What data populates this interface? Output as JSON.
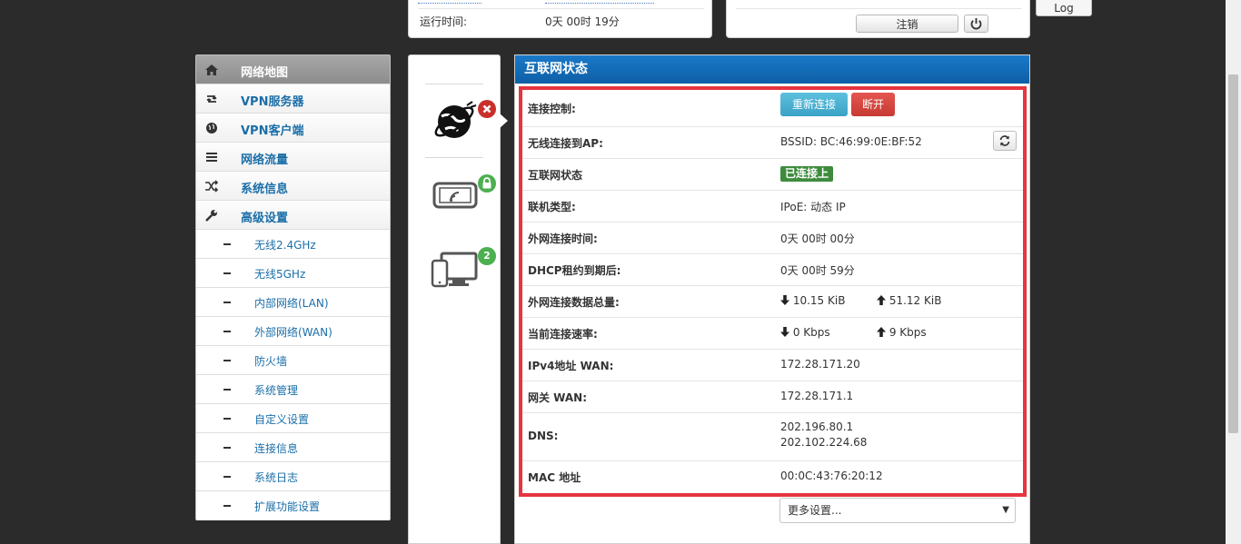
{
  "top_left": {
    "uptime_label": "运行时间:",
    "uptime_value": "0天 00时 19分"
  },
  "top_right": {
    "logout_label": "注销"
  },
  "log_button": "Log",
  "menu": {
    "items": [
      {
        "label": "网络地图",
        "icon": "home-icon",
        "active": true
      },
      {
        "label": "VPN服务器",
        "icon": "retweet-icon"
      },
      {
        "label": "VPN客户端",
        "icon": "globe-icon"
      },
      {
        "label": "网络流量",
        "icon": "list-icon"
      },
      {
        "label": "系统信息",
        "icon": "shuffle-icon"
      },
      {
        "label": "高级设置",
        "icon": "wrench-icon"
      }
    ],
    "sub_items": [
      "无线2.4GHz",
      "无线5GHz",
      "内部网络(LAN)",
      "外部网络(WAN)",
      "防火墙",
      "系统管理",
      "自定义设置",
      "连接信息",
      "系统日志",
      "扩展功能设置"
    ]
  },
  "icons": {
    "client_count": "2"
  },
  "panel": {
    "title": "互联网状态",
    "reconnect": "重新连接",
    "disconnect": "断开",
    "rows": {
      "control": "连接控制:",
      "ap_label": "无线连接到AP:",
      "ap_value": "BSSID: BC:46:99:0E:BF:52",
      "status_label": "互联网状态",
      "status_value": "已连接上",
      "type_label": "联机类型:",
      "type_value": "IPoE: 动态 IP",
      "wan_time_label": "外网连接时间:",
      "wan_time_value": "0天 00时 00分",
      "dhcp_label": "DHCP租约到期后:",
      "dhcp_value": "0天 00时 59分",
      "total_label": "外网连接数据总量:",
      "total_down": "10.15 KiB",
      "total_up": "51.12 KiB",
      "rate_label": "当前连接速率:",
      "rate_down": "0 Kbps",
      "rate_up": "9 Kbps",
      "ipv4_label": "IPv4地址 WAN:",
      "ipv4_value": "172.28.171.20",
      "gw_label": "网关 WAN:",
      "gw_value": "172.28.171.1",
      "dns_label": "DNS:",
      "dns1": "202.196.80.1",
      "dns2": "202.102.224.68",
      "mac_label": "MAC 地址",
      "mac_value": "00:0C:43:76:20:12"
    },
    "more_select": "更多设置..."
  }
}
